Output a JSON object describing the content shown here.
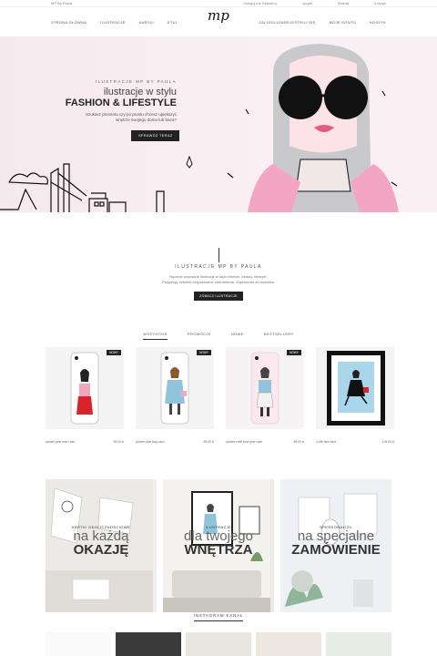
{
  "topbar": {
    "site": "MP By Paula",
    "links": [
      "Zaloguj lub Rejestruj",
      "Języki",
      "Waluta",
      "Koszyk"
    ]
  },
  "nav": {
    "left": [
      "STRONA GŁÓWNA",
      "ILUSTRACJE",
      "KARTKI",
      "ETUI"
    ],
    "logo": "mp",
    "right": [
      "ZALOGUJ/ZAREJESTRUJ SIĘ",
      "MOJE KONTO",
      "KOSZYK"
    ]
  },
  "hero": {
    "sub": "ILUSTRACJE MP BY PAULA",
    "title": "ilustracje w stylu",
    "title2": "FASHION & LIFESTYLE",
    "desc": "Szukasz prezentu czy po prostu chcesz upiększyć wnętrze swojego domu lub biura?",
    "button": "SPRAWDŹ TERAZ"
  },
  "intro": {
    "title": "ILUSTRACJE MP BY PAULA",
    "line1": "Ręcznie rysowane ilustracje w stylu fashion, beauty, lifestyle.",
    "line2": "Przyjmuję również indywidualne zamówienia. Zapraszam do kontaktu.",
    "button": "ZOBACZ ILUSTRACJE"
  },
  "tabs": [
    "WSZYSTKIE",
    "PROMOCJE",
    "NOWE",
    "BESTSELLERY"
  ],
  "products": [
    {
      "name": "Iphone pink rose case",
      "price": "89,00 zł",
      "badge": "NOWY"
    },
    {
      "name": "Iphone blue bag case",
      "price": "89,00 zł",
      "badge": "NOWY"
    },
    {
      "name": "Iphone coffe time pink case",
      "price": "89,00 zł",
      "badge": "NOWY"
    },
    {
      "name": "Coffe time blue",
      "price": "129,00 zł",
      "badge": ""
    }
  ],
  "categories": [
    {
      "small": "KARTKI OKOLICZNOŚCIOWE",
      "l1": "na każdą",
      "l2": "OKAZJĘ"
    },
    {
      "small": "ILUSTRACJE",
      "l1": "dla twojego",
      "l2": "WNĘTRZA"
    },
    {
      "small": "SPERSONALIZU",
      "l1": "na specjalne",
      "l2": "ZAMÓWIENIE"
    }
  ],
  "instagram": "INSTAGRAM KANAŁ",
  "colors": {
    "accent": "#222222",
    "hero_bg": "#f7ebef",
    "pink": "#f3a6c2"
  }
}
